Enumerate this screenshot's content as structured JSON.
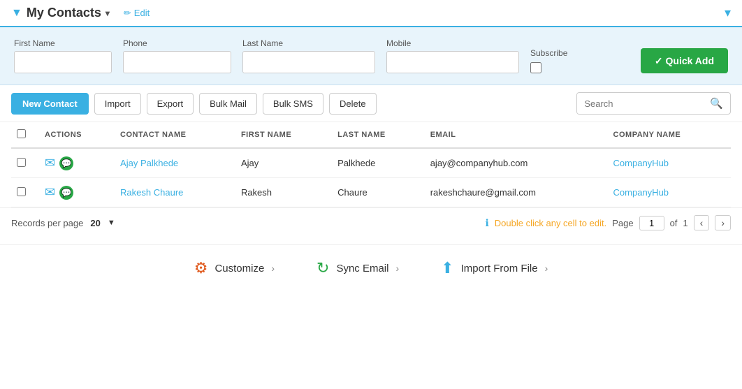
{
  "header": {
    "title": "My Contacts",
    "caret": "▾",
    "edit_label": "Edit",
    "filter_icon": "▼",
    "pencil_unicode": "✏"
  },
  "quick_add": {
    "first_name_label": "First Name",
    "phone_label": "Phone",
    "last_name_label": "Last Name",
    "mobile_label": "Mobile",
    "subscribe_label": "Subscribe",
    "button_label": "✓ Quick Add"
  },
  "toolbar": {
    "new_contact_label": "New Contact",
    "import_label": "Import",
    "export_label": "Export",
    "bulk_mail_label": "Bulk Mail",
    "bulk_sms_label": "Bulk SMS",
    "delete_label": "Delete",
    "search_placeholder": "Search"
  },
  "table": {
    "columns": [
      {
        "key": "actions",
        "label": "ACTIONS"
      },
      {
        "key": "contact_name",
        "label": "CONTACT NAME"
      },
      {
        "key": "first_name",
        "label": "FIRST NAME"
      },
      {
        "key": "last_name",
        "label": "LAST NAME"
      },
      {
        "key": "email",
        "label": "EMAIL"
      },
      {
        "key": "company_name",
        "label": "COMPANY NAME"
      }
    ],
    "rows": [
      {
        "contact_name": "Ajay Palkhede",
        "first_name": "Ajay",
        "last_name": "Palkhede",
        "email": "ajay@companyhub.com",
        "company_name": "CompanyHub"
      },
      {
        "contact_name": "Rakesh Chaure",
        "first_name": "Rakesh",
        "last_name": "Chaure",
        "email": "rakeshchaure@gmail.com",
        "company_name": "CompanyHub"
      }
    ]
  },
  "footer": {
    "records_per_page_label": "Records per page",
    "records_count": "20",
    "hint_text": "Double click any cell to edit.",
    "page_label": "Page",
    "current_page": "1",
    "of_label": "of",
    "total_pages": "1"
  },
  "bottom_actions": [
    {
      "key": "customize",
      "label": "Customize",
      "arrow": "›"
    },
    {
      "key": "sync_email",
      "label": "Sync Email",
      "arrow": "›"
    },
    {
      "key": "import_from_file",
      "label": "Import From File",
      "arrow": "›"
    }
  ]
}
